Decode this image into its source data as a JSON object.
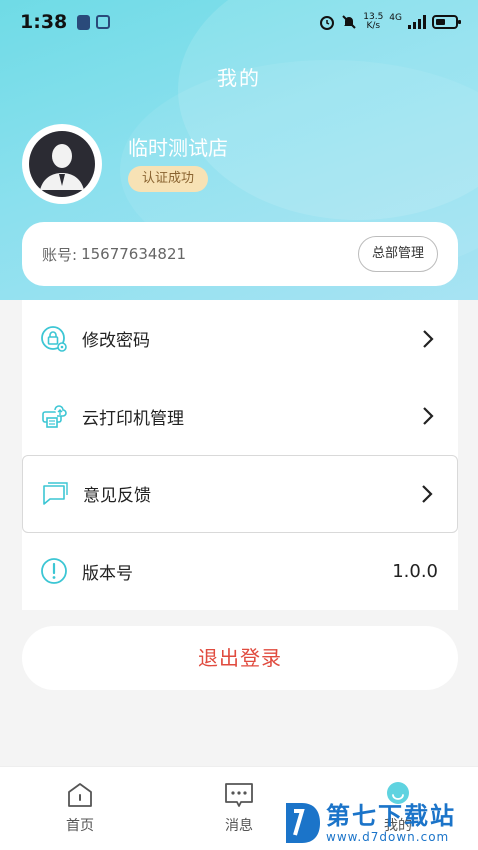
{
  "status_bar": {
    "time": "1:38",
    "net_speed_top": "13.5",
    "net_speed_bottom": "K/s",
    "network": "4G"
  },
  "header": {
    "title": "我的",
    "store_name": "临时测试店",
    "verify_badge": "认证成功"
  },
  "account": {
    "label": "账号:",
    "number": "15677634821",
    "hq_button": "总部管理"
  },
  "menu": {
    "items": [
      {
        "label": "修改密码",
        "icon": "lock-gear-icon"
      },
      {
        "label": "云打印机管理",
        "icon": "cloud-printer-icon"
      },
      {
        "label": "意见反馈",
        "icon": "chat-bubble-icon"
      },
      {
        "label": "版本号",
        "icon": "info-circle-icon",
        "value": "1.0.0"
      }
    ]
  },
  "logout": {
    "label": "退出登录"
  },
  "tab_bar": {
    "tabs": [
      {
        "label": "首页",
        "icon": "home-icon"
      },
      {
        "label": "消息",
        "icon": "message-icon"
      },
      {
        "label": "我的",
        "icon": "profile-icon"
      }
    ]
  },
  "watermark": {
    "main": "第七下载站",
    "sub": "www.d7down.com"
  },
  "colors": {
    "header_gradient_start": "#6fdbe6",
    "header_gradient_end": "#a7e3f3",
    "accent_teal": "#3cc6d4",
    "logout_red": "#e04b3f",
    "badge_bg": "#f7e2b5",
    "badge_text": "#8a6431",
    "watermark_blue": "#1b74c9"
  }
}
